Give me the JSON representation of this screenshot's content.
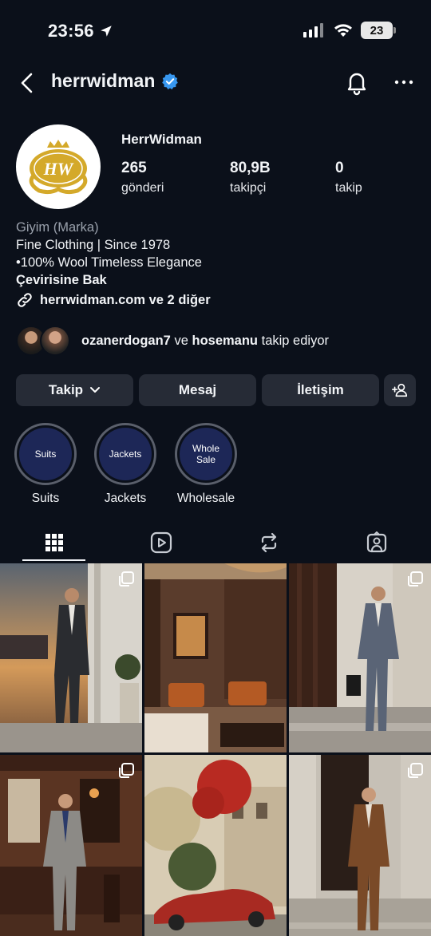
{
  "status_bar": {
    "time": "23:56",
    "battery": "23"
  },
  "header": {
    "username": "herrwidman"
  },
  "profile": {
    "display_name": "HerrWidman",
    "stats": [
      {
        "value": "265",
        "label": "gönderi"
      },
      {
        "value": "80,9B",
        "label": "takipçi"
      },
      {
        "value": "0",
        "label": "takip"
      }
    ],
    "category": "Giyim (Marka)",
    "bio_lines": [
      "Fine Clothing | Since 1978",
      "•100% Wool Timeless Elegance"
    ],
    "translate": "Çevirisine Bak",
    "link": "herrwidman.com ve 2 diğer",
    "followed_by": {
      "user1": "ozanerdogan7",
      "connector": "ve",
      "user2": "hosemanu",
      "suffix": "takip ediyor"
    }
  },
  "actions": {
    "follow": "Takip",
    "message": "Mesaj",
    "contact": "İletişim"
  },
  "highlights": [
    {
      "cover_text": "Suits",
      "label": "Suits"
    },
    {
      "cover_text": "Jackets",
      "label": "Jackets"
    },
    {
      "cover_text": "Whole\nSale",
      "label": "Wholesale"
    }
  ],
  "colors": {
    "background": "#0b101a",
    "button": "#262b36",
    "verified": "#3797f0",
    "highlight_cover": "#1d2757",
    "logo_gold": "#d4a92a"
  },
  "logo_text": "HW"
}
